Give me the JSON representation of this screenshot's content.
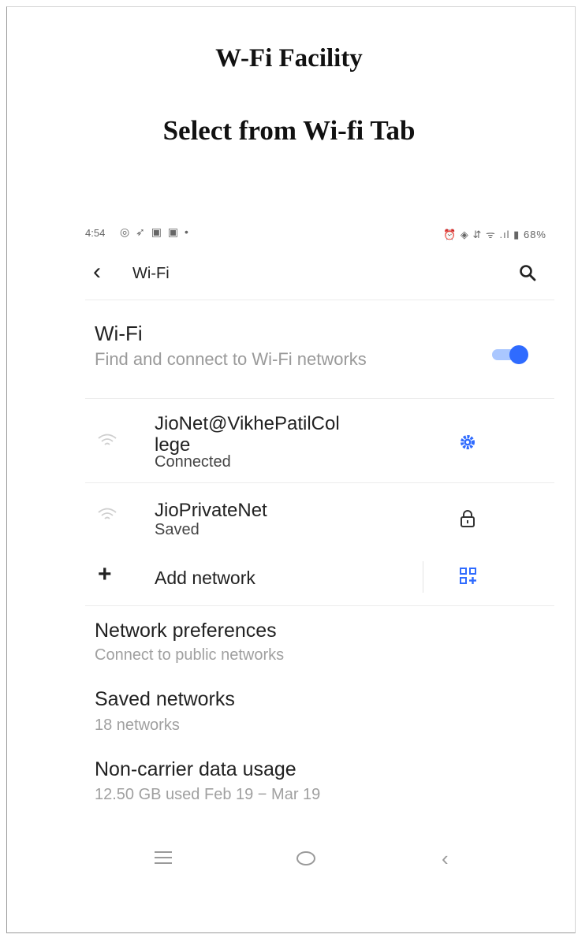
{
  "document": {
    "heading": "W-Fi Facility",
    "subheading": "Select from Wi-fi Tab"
  },
  "status_bar": {
    "time": "4:54",
    "battery": "68%",
    "left_icons": "◎ ➶ ▣ ▣ •",
    "right_icons": "⏰ ◈ ⇵ ᯤ .ıl ▮"
  },
  "header": {
    "back_icon": "chevron-left-icon",
    "title": "Wi-Fi",
    "search_icon": "search-icon"
  },
  "wifi_toggle": {
    "title": "Wi-Fi",
    "subtitle": "Find and connect to Wi-Fi networks",
    "state": "on",
    "accent": "#2f6bff"
  },
  "networks": [
    {
      "name_line1": "JioNet@VikhePatilCol",
      "name_line2": "lege",
      "status": "Connected",
      "action_icon": "gear-icon"
    },
    {
      "name_line1": "JioPrivateNet",
      "status": "Saved",
      "action_icon": "lock-icon"
    }
  ],
  "add_network": {
    "label": "Add network",
    "qr_icon": "qr-code-icon"
  },
  "preferences": [
    {
      "title": "Network preferences",
      "subtitle": "Connect to public networks"
    },
    {
      "title": "Saved networks",
      "subtitle": "18 networks"
    },
    {
      "title": "Non-carrier data usage",
      "subtitle": "12.50 GB used Feb 19 − Mar 19"
    }
  ],
  "nav_bar": {
    "items": [
      "recent-apps-icon",
      "home-icon",
      "back-icon"
    ]
  }
}
